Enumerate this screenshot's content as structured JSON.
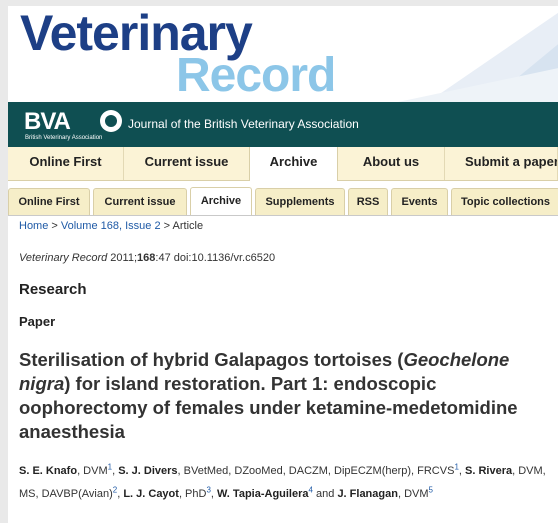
{
  "masthead": {
    "logo_line1": "Veterinary",
    "logo_line2": "Record"
  },
  "bva_bar": {
    "logo_text": "BVA",
    "logo_subtitle": "British Veterinary Association",
    "journal_name": "Journal of the British Veterinary Association"
  },
  "nav_primary": [
    {
      "label": "Online First"
    },
    {
      "label": "Current issue"
    },
    {
      "label": "Archive"
    },
    {
      "label": "About us"
    },
    {
      "label": "Submit a paper"
    }
  ],
  "nav_secondary": [
    {
      "label": "Online First"
    },
    {
      "label": "Current issue"
    },
    {
      "label": "Archive"
    },
    {
      "label": "Supplements"
    },
    {
      "label": "RSS"
    },
    {
      "label": "Events"
    },
    {
      "label": "Topic collections"
    }
  ],
  "breadcrumb": {
    "home": "Home",
    "sep1": " > ",
    "volume": "Volume 168, Issue 2",
    "sep2": " > Article"
  },
  "citation": {
    "journal": "Veterinary Record",
    "year_pre": " 2011;",
    "volume": "168",
    "rest": ":47 doi:10.1136/vr.c6520"
  },
  "article": {
    "section": "Research",
    "subsection": "Paper",
    "title_part1": "Sterilisation of hybrid Galapagos tortoises (",
    "title_species": "Geochelone nigra",
    "title_part2": ") for island restoration. Part 1: endoscopic oophorectomy of females under ketamine-medetomidine anaesthesia"
  },
  "authors": [
    {
      "name": "S. E. Knafo",
      "creds": ", DVM",
      "aff": "1",
      "after": ", "
    },
    {
      "name": "S. J. Divers",
      "creds": ", BVetMed, DZooMed, DACZM, DipECZM(herp), FRCVS",
      "aff": "1",
      "after": ", "
    },
    {
      "name": "S. Rivera",
      "creds": ", DVM, MS, DAVBP(Avian)",
      "aff": "2",
      "after": ", "
    },
    {
      "name": "L. J. Cayot",
      "creds": ", PhD",
      "aff": "3",
      "after": ", "
    },
    {
      "name": "W. Tapia-Aguilera",
      "creds": "",
      "aff": "4",
      "after": " and "
    },
    {
      "name": "J. Flanagan",
      "creds": ", DVM",
      "aff": "5",
      "after": ""
    }
  ],
  "colors": {
    "logo_dark_blue": "#1d3f86",
    "logo_light_blue": "#8cc6e8",
    "bva_bar": "#0f4f52",
    "link_blue": "#1f5aa6",
    "nav_bg": "#fbf3d6"
  }
}
